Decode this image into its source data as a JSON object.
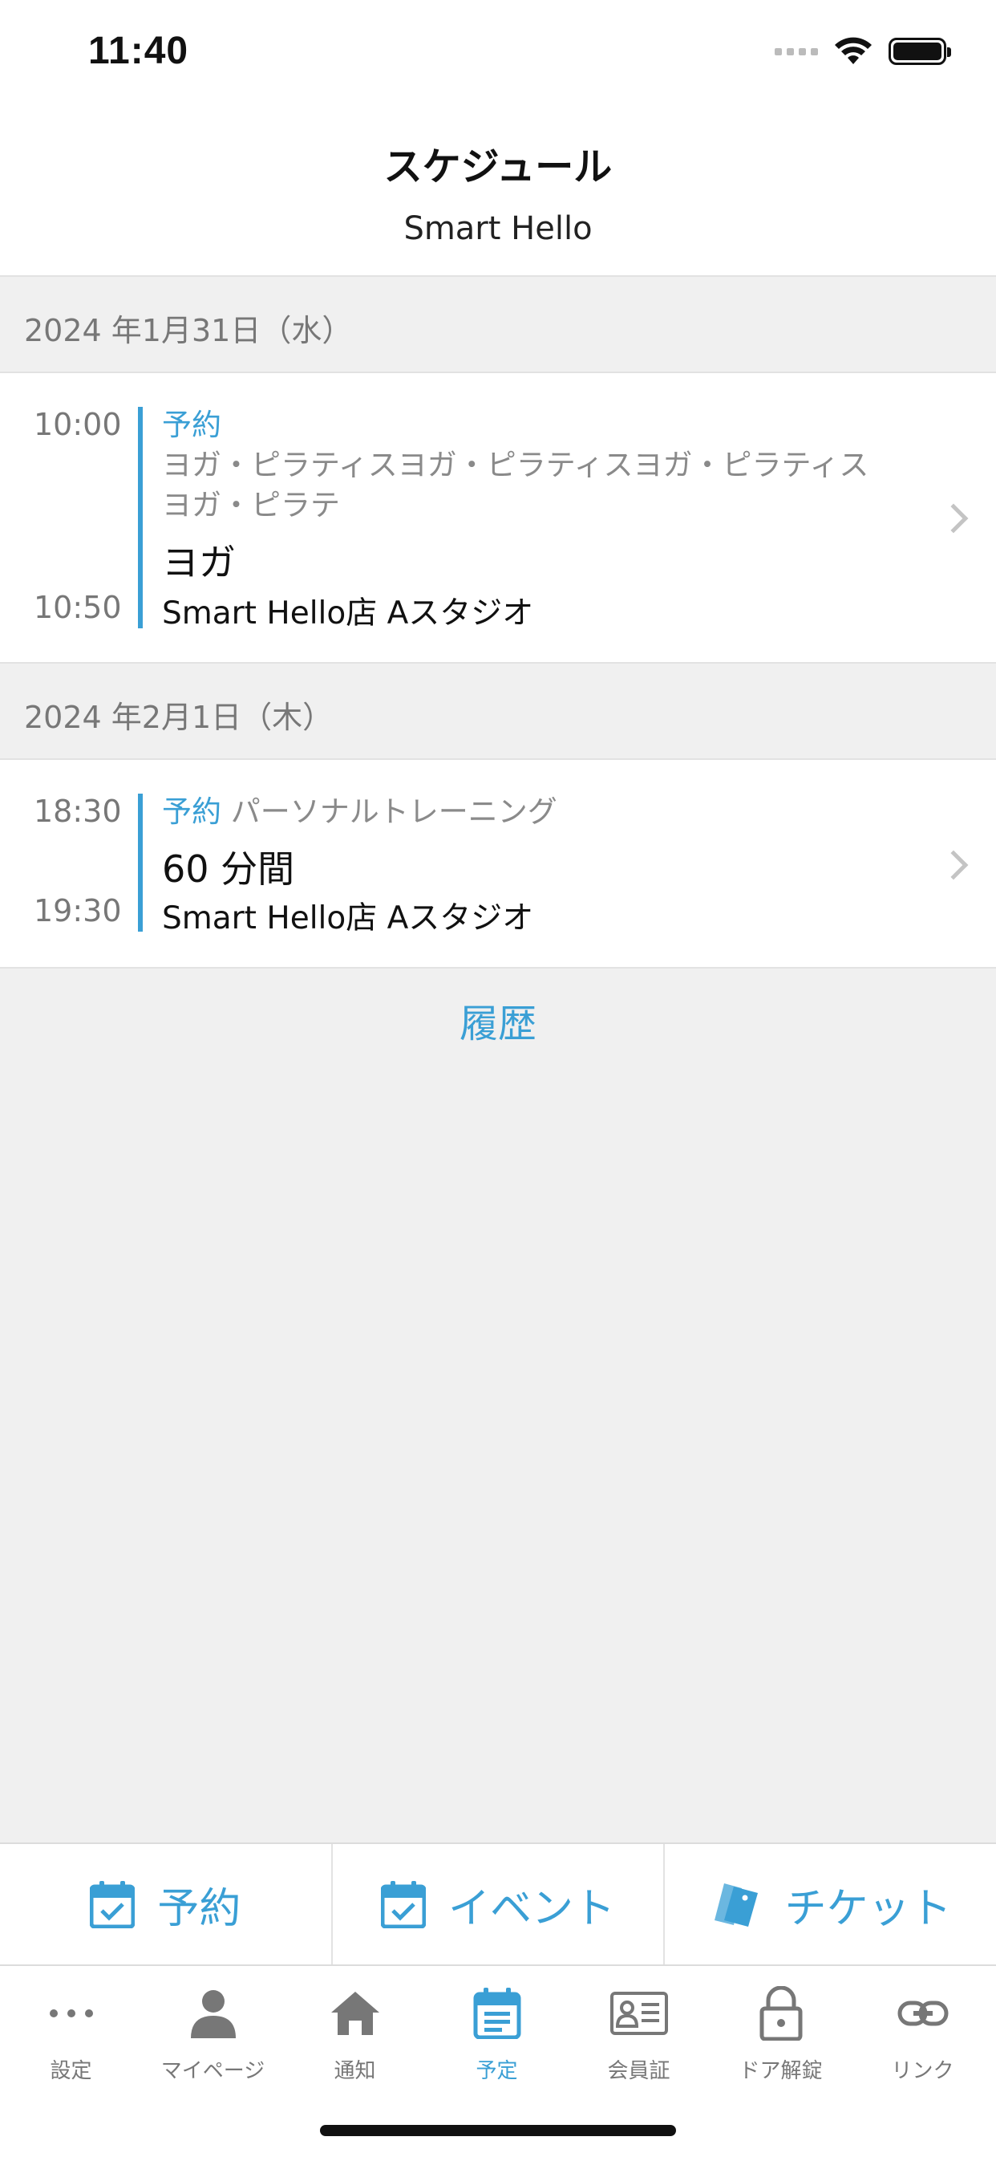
{
  "status_bar": {
    "time": "11:40"
  },
  "header": {
    "title": "スケジュール",
    "subtitle": "Smart Hello"
  },
  "sections": [
    {
      "date": "2024 年1月31日（水）",
      "events": [
        {
          "start": "10:00",
          "end": "10:50",
          "kind": "予約",
          "category": "ヨガ・ピラティスヨガ・ピラティスヨガ・ピラティスヨガ・ピラテ",
          "title": "ヨガ",
          "place": "Smart Hello店 Aスタジオ"
        }
      ]
    },
    {
      "date": "2024 年2月1日（木）",
      "events": [
        {
          "start": "18:30",
          "end": "19:30",
          "kind": "予約",
          "category": "パーソナルトレーニング",
          "title": "60 分間",
          "place": "Smart Hello店 Aスタジオ"
        }
      ]
    }
  ],
  "history_label": "履歴",
  "actions": [
    {
      "label": "予約",
      "icon": "calendar-check-icon"
    },
    {
      "label": "イベント",
      "icon": "calendar-check-icon"
    },
    {
      "label": "チケット",
      "icon": "ticket-icon"
    }
  ],
  "tabs": [
    {
      "label": "設定",
      "icon": "more-icon"
    },
    {
      "label": "マイページ",
      "icon": "person-icon"
    },
    {
      "label": "通知",
      "icon": "home-icon"
    },
    {
      "label": "予定",
      "icon": "schedule-icon",
      "active": true
    },
    {
      "label": "会員証",
      "icon": "id-card-icon"
    },
    {
      "label": "ドア解錠",
      "icon": "lock-icon"
    },
    {
      "label": "リンク",
      "icon": "link-icon"
    }
  ],
  "colors": {
    "accent": "#3a9fd5",
    "background": "#f0f0f0",
    "muted_text": "#777777"
  }
}
